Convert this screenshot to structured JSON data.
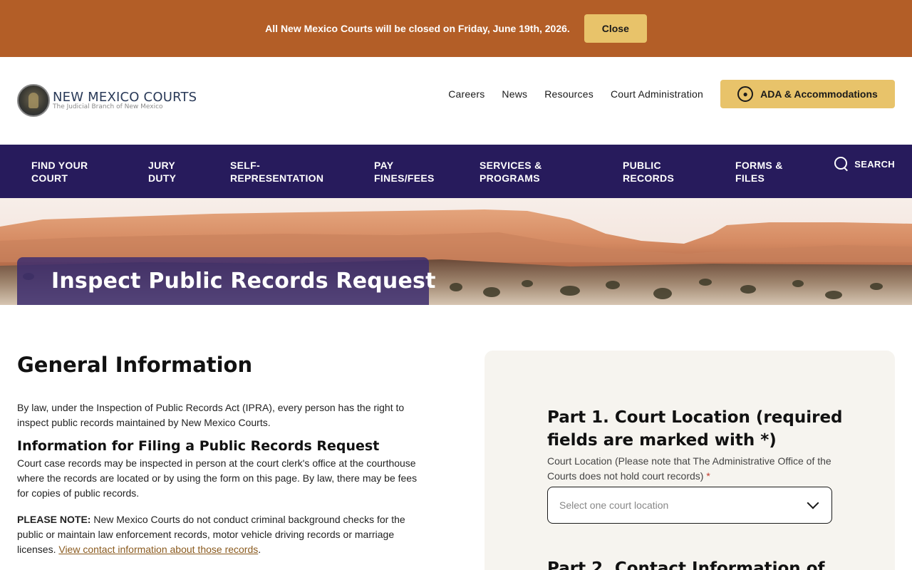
{
  "alert": {
    "message": "All New Mexico Courts will be closed on Friday, June 19th, 2026.",
    "close_label": "Close"
  },
  "header": {
    "logo_title": "NEW MEXICO COURTS",
    "logo_subtitle": "The Judicial Branch of New Mexico",
    "links": [
      "Careers",
      "News",
      "Resources",
      "Court Administration"
    ],
    "ada_label": "ADA & Accommodations",
    "ada_icon": "accessibility-icon"
  },
  "nav": {
    "items": [
      {
        "line1": "FIND YOUR",
        "line2": "COURT"
      },
      {
        "line1": "JURY",
        "line2": "DUTY"
      },
      {
        "line1": "SELF-",
        "line2": "REPRESENTATION"
      },
      {
        "line1": "PAY",
        "line2": "FINES/FEES"
      },
      {
        "line1": "SERVICES &",
        "line2": "PROGRAMS"
      },
      {
        "line1": "PUBLIC",
        "line2": "RECORDS"
      },
      {
        "line1": "FORMS &",
        "line2": "FILES"
      }
    ],
    "search_label": "SEARCH",
    "search_icon": "search-icon"
  },
  "hero": {
    "title": "Inspect Public Records Request"
  },
  "main": {
    "heading": "General Information",
    "intro": "By law, under the Inspection of Public Records Act (IPRA), every person has the right to inspect public records maintained by New Mexico Courts.",
    "filing_heading": "Information for Filing a Public Records Request",
    "filing_text": "Court case records may be inspected in person at the court clerk's office at the courthouse where the records are located or by using the form on this page. By law, there may be fees for copies of public records.",
    "note_label": "PLEASE NOTE:",
    "note_text": " New Mexico Courts do not conduct criminal background checks for the public or maintain law enforcement records, motor vehicle driving records or marriage licenses. ",
    "note_link": "View contact information about those records",
    "note_end": "."
  },
  "form": {
    "part1_title": "Part 1. Court Location (required fields are marked with *)",
    "location_label": "Court Location (Please note that The Administrative Office of the Courts does not hold court records) ",
    "required_mark": "*",
    "location_placeholder": "Select one court location",
    "part2_title": "Part 2. Contact Information of"
  },
  "colors": {
    "alert_bg": "#b35e27",
    "accent_gold": "#e8c36a",
    "nav_bg": "#271b5c",
    "link": "#8a5a1e"
  }
}
